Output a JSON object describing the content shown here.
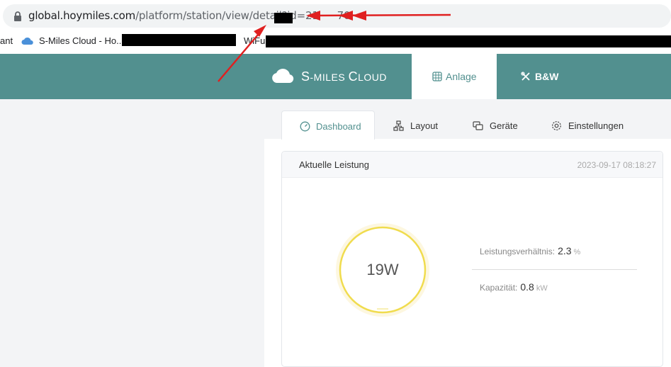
{
  "browser": {
    "url_domain": "global.hoymiles.com",
    "url_path": "/platform/station/view/detail?id=21",
    "url_tail": "70"
  },
  "bookmarks": {
    "items": [
      "ant",
      "S-Miles Cloud - Ho...",
      "WiFu"
    ]
  },
  "header": {
    "logo_text_s": "S",
    "logo_text_miles": "-MILES ",
    "logo_text_c": "C",
    "logo_text_loud": "LOUD",
    "nav_anlage": "Anlage",
    "nav_bw": "B&W"
  },
  "tabs": [
    "Dashboard",
    "Layout",
    "Geräte",
    "Einstellungen"
  ],
  "card": {
    "title": "Aktuelle Leistung",
    "timestamp": "2023-09-17 08:18:27",
    "power_value": "19W",
    "stats": [
      {
        "label": "Leistungsverhältnis:",
        "value": "2.3",
        "unit": "%"
      },
      {
        "label": "Kapazität:",
        "value": "0.8",
        "unit": "kW"
      }
    ]
  },
  "colors": {
    "header_bg": "#52908f",
    "accent": "#52908f",
    "gauge": "#f0dc4e",
    "annotation": "#e02020"
  }
}
